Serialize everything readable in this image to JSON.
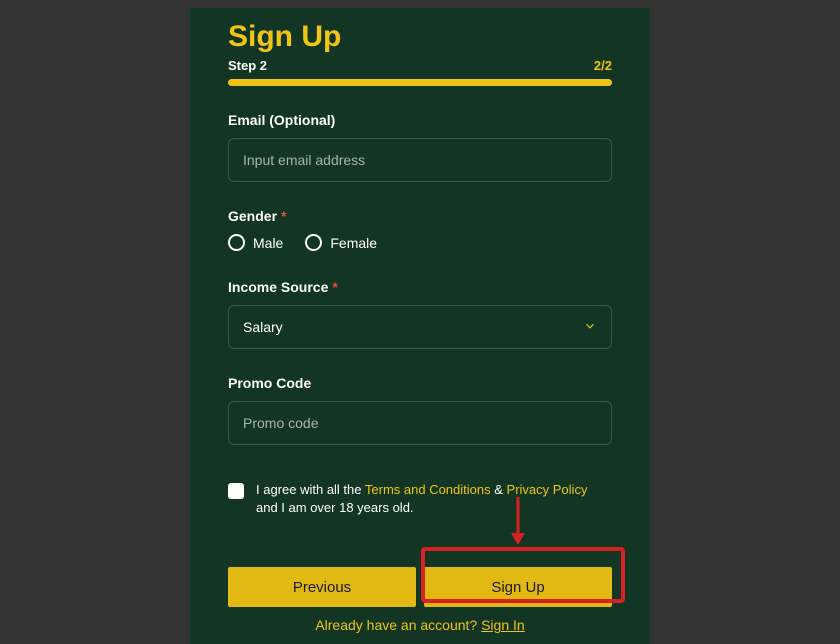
{
  "title": "Sign Up",
  "step": {
    "label": "Step 2",
    "count": "2/2"
  },
  "email": {
    "label": "Email (Optional)",
    "placeholder": "Input email address"
  },
  "gender": {
    "label": "Gender",
    "male": "Male",
    "female": "Female"
  },
  "income": {
    "label": "Income Source",
    "selected": "Salary"
  },
  "promo": {
    "label": "Promo Code",
    "placeholder": "Promo code"
  },
  "agree": {
    "pre": "I agree with all the ",
    "terms": "Terms and Conditions",
    "amp": " & ",
    "privacy": "Privacy Policy",
    "post": " and I am over 18 years old."
  },
  "buttons": {
    "prev": "Previous",
    "signup": "Sign Up"
  },
  "bottom": {
    "q": "Already have an account?  ",
    "signin": "Sign In"
  }
}
